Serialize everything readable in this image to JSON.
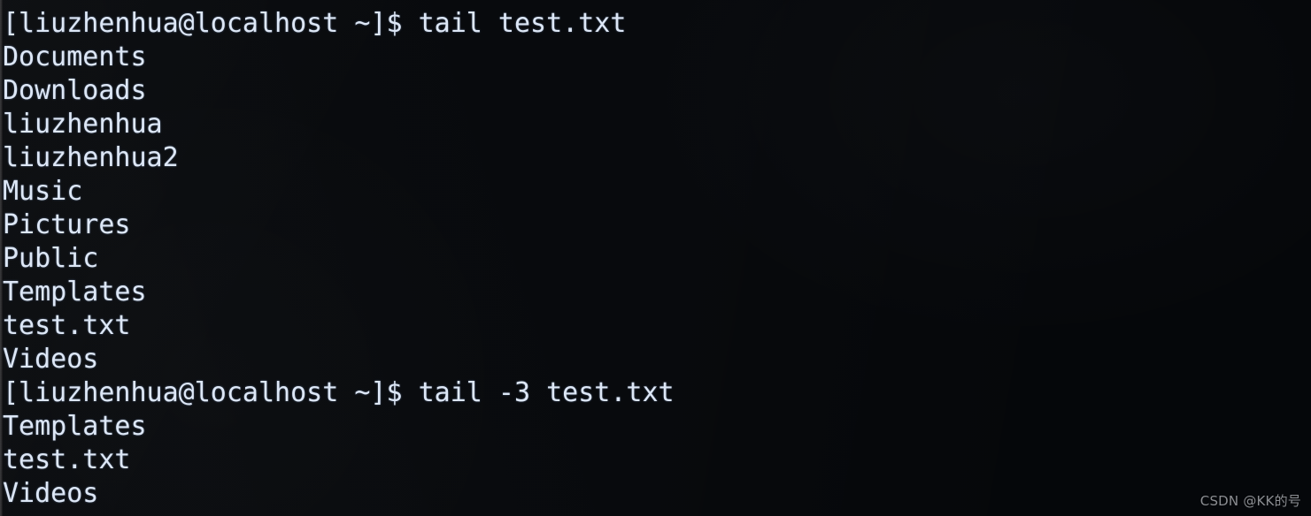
{
  "terminal": {
    "shell_prompt": "[liuzhenhua@localhost ~]$ ",
    "user": "liuzhenhua",
    "host": "localhost",
    "cwd": "~",
    "colors": {
      "background": "#05070a",
      "foreground": "#dde7f6",
      "watermark": "#8b8d91",
      "left_edge": "#333335"
    },
    "lines": [
      {
        "type": "prompt",
        "text": "[liuzhenhua@localhost ~]$ tail test.txt"
      },
      {
        "type": "output",
        "text": "Documents"
      },
      {
        "type": "output",
        "text": "Downloads"
      },
      {
        "type": "output",
        "text": "liuzhenhua"
      },
      {
        "type": "output",
        "text": "liuzhenhua2"
      },
      {
        "type": "output",
        "text": "Music"
      },
      {
        "type": "output",
        "text": "Pictures"
      },
      {
        "type": "output",
        "text": "Public"
      },
      {
        "type": "output",
        "text": "Templates"
      },
      {
        "type": "output",
        "text": "test.txt"
      },
      {
        "type": "output",
        "text": "Videos"
      },
      {
        "type": "prompt",
        "text": "[liuzhenhua@localhost ~]$ tail -3 test.txt"
      },
      {
        "type": "output",
        "text": "Templates"
      },
      {
        "type": "output",
        "text": "test.txt"
      },
      {
        "type": "output",
        "text": "Videos"
      }
    ],
    "commands": [
      {
        "command": "tail test.txt",
        "output": [
          "Documents",
          "Downloads",
          "liuzhenhua",
          "liuzhenhua2",
          "Music",
          "Pictures",
          "Public",
          "Templates",
          "test.txt",
          "Videos"
        ]
      },
      {
        "command": "tail -3 test.txt",
        "output": [
          "Templates",
          "test.txt",
          "Videos"
        ]
      }
    ]
  },
  "watermark": {
    "text": "CSDN @KK的号"
  }
}
